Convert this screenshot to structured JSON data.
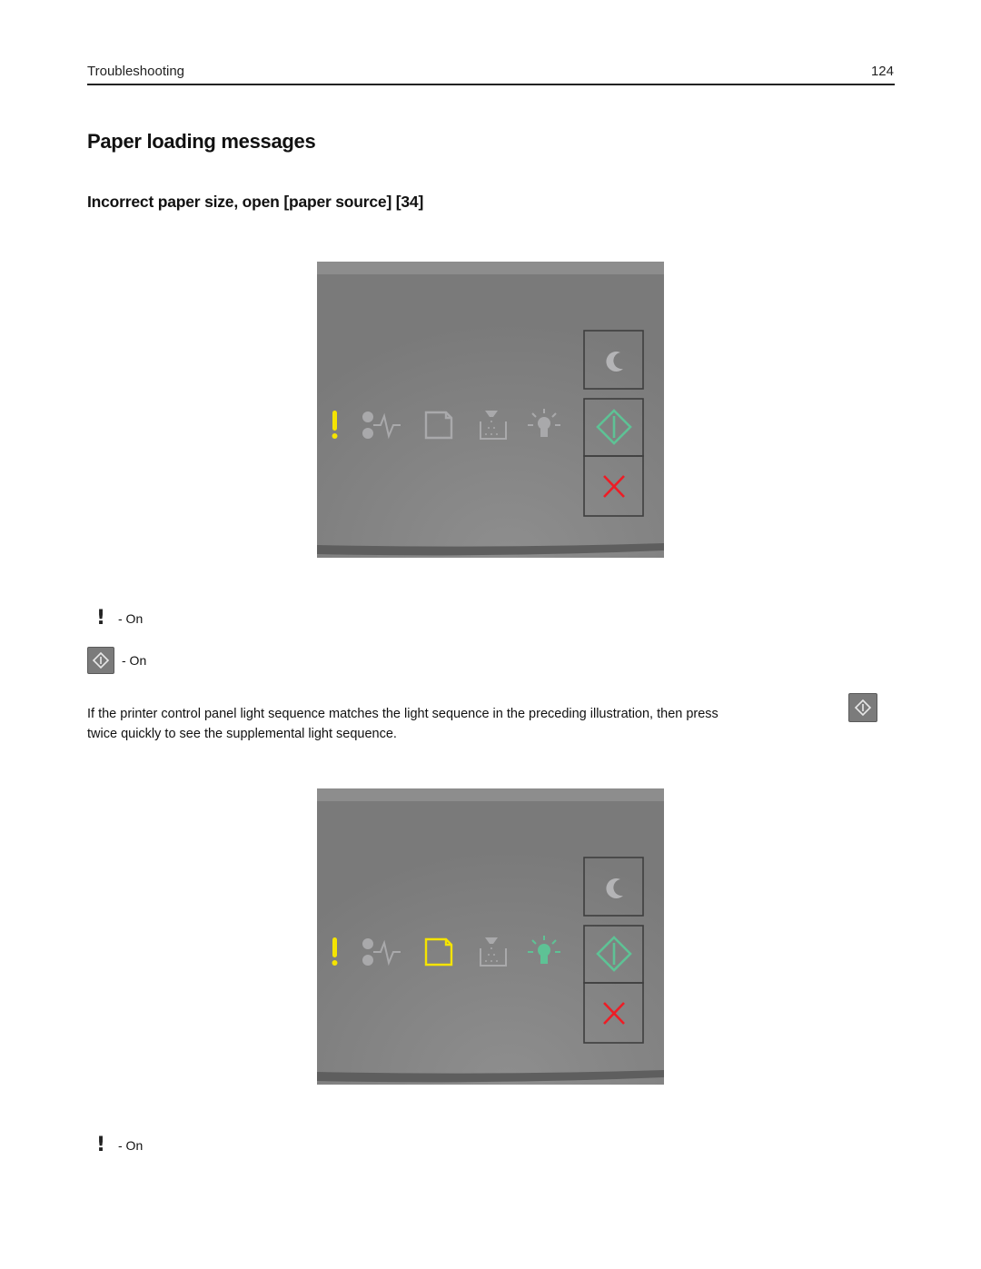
{
  "header": {
    "section": "Troubleshooting",
    "page_number": "124"
  },
  "title": "Paper loading messages",
  "subtitle": "Incorrect paper size, open [paper source] [34]",
  "colors": {
    "panel_gray": "#7a7a7a",
    "indicator_off": "#a9a9ab",
    "yellow_on": "#f5e400",
    "green_on": "#5ec295",
    "cancel_red": "#ee1c25"
  },
  "panels": [
    {
      "name": "primary-light-sequence",
      "indicators": {
        "error": "on",
        "paper_jam": "off",
        "load_paper": "off",
        "toner": "off",
        "ready": "off"
      },
      "buttons": [
        "sleep",
        "start",
        "cancel"
      ]
    },
    {
      "name": "supplemental-light-sequence",
      "indicators": {
        "error": "on",
        "paper_jam": "off",
        "load_paper": "on",
        "toner": "off",
        "ready": "on"
      },
      "buttons": [
        "sleep",
        "start",
        "cancel"
      ]
    }
  ],
  "legend_1": [
    {
      "icon": "error-exclamation-icon",
      "text": "- On"
    },
    {
      "icon": "start-button-icon",
      "text": "- On"
    }
  ],
  "paragraph": {
    "text": "If the printer control panel light sequence matches the light sequence in the preceding illustration, then press",
    "text_end": "twice quickly to see the supplemental light sequence.",
    "inline_icon": "start-button-icon"
  },
  "legend_2": [
    {
      "icon": "error-exclamation-icon",
      "text": "- On"
    }
  ]
}
